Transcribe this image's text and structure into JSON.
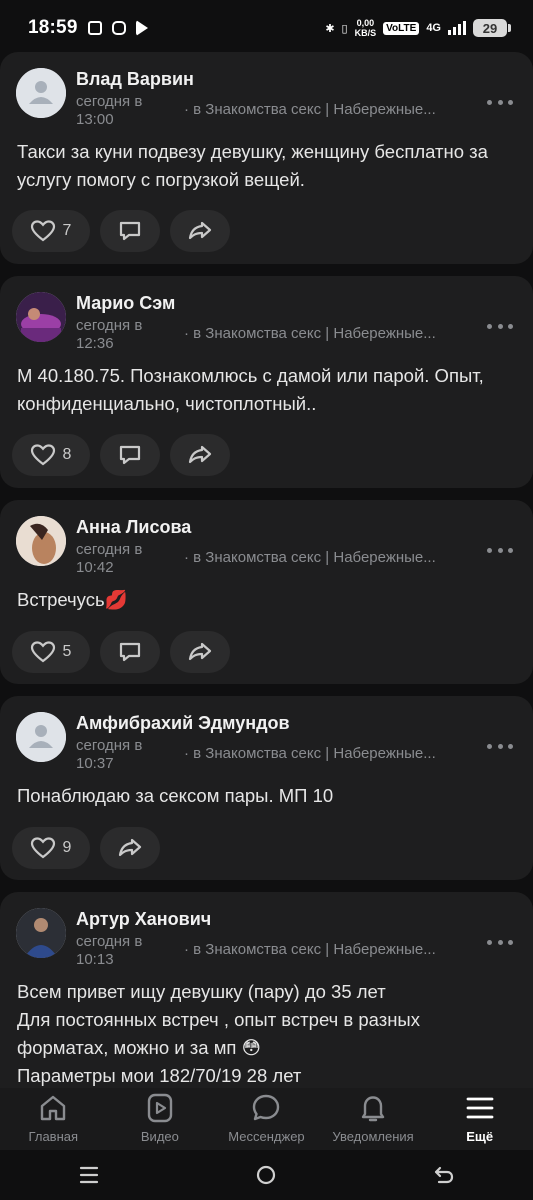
{
  "status_bar": {
    "time": "18:59",
    "speed_top": "0,00",
    "speed_bottom": "KB/S",
    "volte": "VoLTE",
    "network": "4G",
    "battery": "29"
  },
  "posts": [
    {
      "author": "Влад Варвин",
      "time": "сегодня в 13:00",
      "group": "в Знакомства секс | Набережные...",
      "text": "Такси за куни подвезу девушку, женщину бесплатно за услугу помогу с погрузкой вещей.",
      "likes": "7",
      "avatar": "default-avatar-icon"
    },
    {
      "author": "Марио Сэм",
      "time": "сегодня в 12:36",
      "group": "в Знакомства секс | Набережные...",
      "text": "М 40.180.75. Познакомлюсь с дамой или парой. Опыт, конфиденциально, чистоплотный..",
      "likes": "8",
      "avatar": "photo-avatar"
    },
    {
      "author": "Анна Лисова",
      "time": "сегодня в 10:42",
      "group": "в Знакомства секс | Набережные...",
      "text": "Встречусь💋",
      "likes": "5",
      "avatar": "photo-avatar"
    },
    {
      "author": "Амфибрахий Эдмундов",
      "time": "сегодня в 10:37",
      "group": "в Знакомства секс | Набережные...",
      "text": "Понаблюдаю за сексом пары. МП 10",
      "likes": "9",
      "avatar": "default-avatar-icon"
    },
    {
      "author": "Артур Ханович",
      "time": "сегодня в 10:13",
      "group": "в Знакомства секс | Набережные...",
      "text_lines": [
        "Всем привет ищу девушку (пару) до 35 лет",
        "Для постоянных встреч , опыт встреч в разных",
        "форматах, можно и за мп 😳",
        "Параметры мои 182/70/19 28 лет"
      ],
      "avatar": "photo-avatar"
    }
  ],
  "bottom_nav": {
    "items": [
      {
        "label": "Главная",
        "icon": "home-icon"
      },
      {
        "label": "Видео",
        "icon": "video-icon"
      },
      {
        "label": "Мессенджер",
        "icon": "messenger-icon"
      },
      {
        "label": "Уведомления",
        "icon": "bell-icon"
      },
      {
        "label": "Ещё",
        "icon": "menu-icon",
        "active": true
      }
    ]
  },
  "colors": {
    "background": "#0f0f10",
    "card": "#1e1e1f",
    "button": "#2b2b2c",
    "muted_text": "#8a8c90",
    "text": "#e6e6e6"
  }
}
